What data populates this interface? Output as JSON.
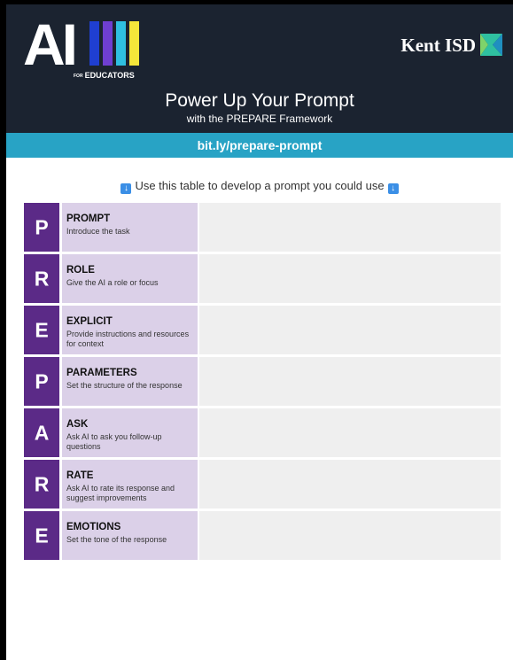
{
  "header": {
    "logo_text": "AI",
    "logo_for": "FOR",
    "logo_educators": "EDUCATORS",
    "logo_bar_colors": [
      "#1f3fd1",
      "#6f3fd1",
      "#2fc0e0",
      "#f5e63a"
    ],
    "org_name": "Kent ISD",
    "title": "Power Up Your Prompt",
    "subtitle": "with the PREPARE Framework"
  },
  "link": "bit.ly/prepare-prompt",
  "instruction": "Use this table to develop a prompt you could use",
  "rows": [
    {
      "letter": "P",
      "name": "PROMPT",
      "desc": "Introduce the task"
    },
    {
      "letter": "R",
      "name": "ROLE",
      "desc": "Give the AI a role or focus"
    },
    {
      "letter": "E",
      "name": "EXPLICIT",
      "desc": "Provide instructions and resources for context"
    },
    {
      "letter": "P",
      "name": "PARAMETERS",
      "desc": "Set the structure of the response"
    },
    {
      "letter": "A",
      "name": "ASK",
      "desc": "Ask AI to ask you follow-up questions"
    },
    {
      "letter": "R",
      "name": "RATE",
      "desc": "Ask AI to rate its response and suggest improvements"
    },
    {
      "letter": "E",
      "name": "EMOTIONS",
      "desc": "Set the tone of the response"
    }
  ],
  "colors": {
    "header_bg": "#1b2330",
    "band": "#28a3c5",
    "letter_bg": "#5b2a87",
    "desc_bg": "#dbd0e8",
    "blank_bg": "#efefef"
  }
}
